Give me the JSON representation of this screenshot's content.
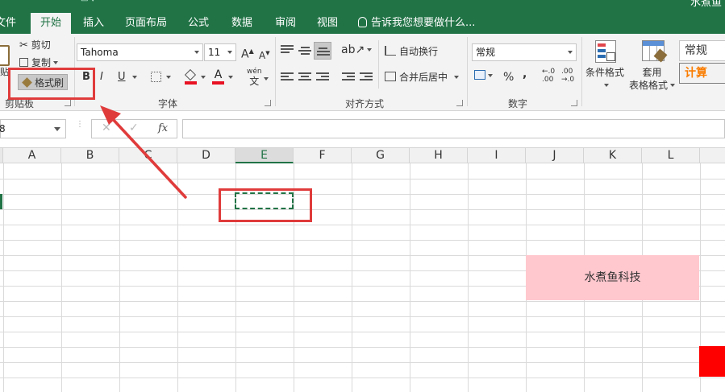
{
  "titlebar": {
    "title_cut": "水煮鱼"
  },
  "tabs": [
    {
      "label": "文件"
    },
    {
      "label": "开始"
    },
    {
      "label": "插入"
    },
    {
      "label": "页面布局"
    },
    {
      "label": "公式"
    },
    {
      "label": "数据"
    },
    {
      "label": "审阅"
    },
    {
      "label": "视图"
    }
  ],
  "tell_me": "告诉我您想要做什么...",
  "clipboard": {
    "cut": "剪切",
    "copy": "复制",
    "format_painter": "格式刷",
    "group_label": "剪贴板",
    "paste_cut": "贴"
  },
  "font": {
    "font_name": "Tahoma",
    "font_size": "11",
    "grow": "A",
    "shrink": "A",
    "bold": "B",
    "italic": "I",
    "underline": "U",
    "font_color_glyph": "A",
    "phonetic_top": "wén",
    "phonetic_bottom": "文",
    "group_label": "字体"
  },
  "alignment": {
    "wrap_text": "自动换行",
    "merge_center": "合并后居中",
    "group_label": "对齐方式"
  },
  "number": {
    "format": "常规",
    "percent": "%",
    "comma": ",",
    "inc_decimal_top": "←.0",
    "inc_decimal_bottom": ".00",
    "dec_decimal_top": ".00",
    "dec_decimal_bottom": "→.0",
    "group_label": "数字"
  },
  "styles": {
    "conditional_formatting": "条件格式",
    "format_as_table_line1": "套用",
    "format_as_table_line2": "表格格式",
    "style_normal": "常规",
    "style_calc": "计算"
  },
  "formula_bar": {
    "namebox_value": "8",
    "cancel": "✕",
    "enter": "✓",
    "fx": "fx"
  },
  "columns": [
    "A",
    "B",
    "C",
    "D",
    "E",
    "F",
    "G",
    "H",
    "I",
    "J",
    "K",
    "L"
  ],
  "cells": {
    "pink_text": "水煮鱼科技"
  },
  "colors": {
    "accent": "#217346",
    "pink_fill": "#ffc7ce",
    "red_fill": "#ff0000",
    "annotation": "#e03b3b"
  }
}
